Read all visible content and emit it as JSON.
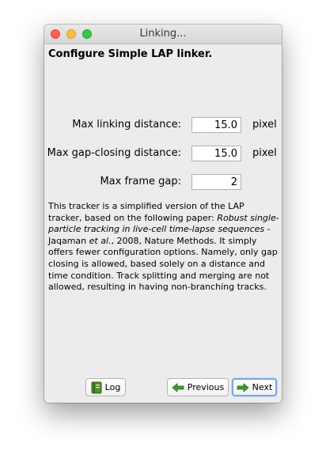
{
  "window": {
    "title": "Linking..."
  },
  "panel": {
    "heading": "Configure Simple LAP linker.",
    "fields": [
      {
        "label": "Max linking distance:",
        "value": "15.0",
        "unit": "pixel"
      },
      {
        "label": "Max gap-closing distance:",
        "value": "15.0",
        "unit": "pixel"
      },
      {
        "label": "Max frame gap:",
        "value": "2",
        "unit": ""
      }
    ],
    "description": {
      "intro": "This tracker is a simplified version of the LAP tracker, based on the following paper:",
      "paper_title": "Robust single-particle tracking in live-cell time-lapse sequences",
      "sep": " - Jaqaman ",
      "et_al": "et al.",
      "citation": ", 2008, Nature Methods.",
      "body": "It simply offers fewer configuration options. Namely, only gap closing is allowed, based solely on a distance and time condition. Track splitting and merging are not allowed, resulting in having non-branching tracks."
    }
  },
  "buttons": {
    "log": {
      "label": "Log",
      "icon": "log-book-icon"
    },
    "previous": {
      "label": "Previous",
      "icon": "arrow-left-icon"
    },
    "next": {
      "label": "Next",
      "icon": "arrow-right-icon"
    }
  },
  "colors": {
    "close": "#fc605c",
    "minimize": "#fdbc40",
    "maximize": "#34c84a",
    "arrow_green": "#3e9a2e",
    "focus_ring": "#7aa7e3"
  }
}
